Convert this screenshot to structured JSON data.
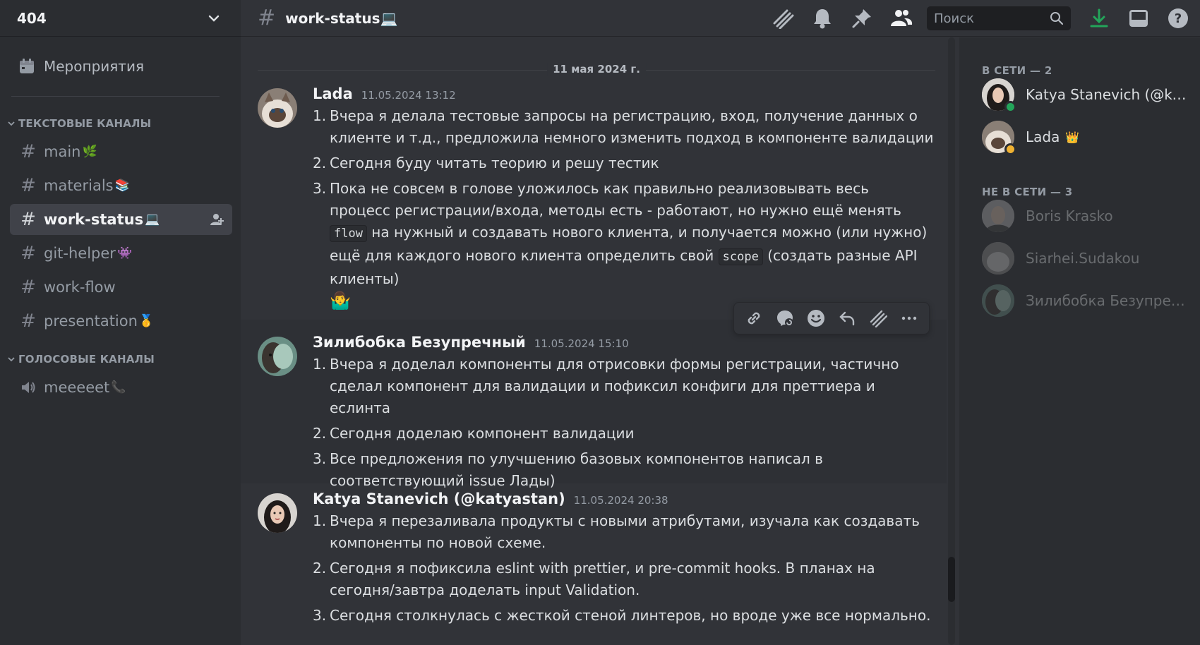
{
  "server": {
    "name": "404"
  },
  "sidebar": {
    "events_label": "Мероприятия",
    "text_category": "ТЕКСТОВЫЕ КАНАЛЫ",
    "voice_category": "ГОЛОСОВЫЕ КАНАЛЫ",
    "channels": [
      {
        "name": "main",
        "emoji": "🌿"
      },
      {
        "name": "materials",
        "emoji": "📚"
      },
      {
        "name": "work-status",
        "emoji": "💻"
      },
      {
        "name": "git-helper",
        "emoji": "👾"
      },
      {
        "name": "work-flow",
        "emoji": ""
      },
      {
        "name": "presentation",
        "emoji": "🥇"
      }
    ],
    "voice_channels": [
      {
        "name": "meeeeet",
        "emoji": "📞"
      }
    ]
  },
  "topbar": {
    "channel_name": "work-status",
    "channel_emoji": "💻",
    "search_placeholder": "Поиск"
  },
  "chat": {
    "date_separator": "11 мая 2024 г.",
    "messages": [
      {
        "author": "Lada",
        "timestamp": "11.05.2024 13:12",
        "items": [
          "Вчера я делала тестовые запросы на регистрацию, вход, получение данных о клиенте и т.д., предложила немного изменить подход в компоненте валидации",
          "Сегодня буду читать теорию и решу тестик",
          {
            "pre": "Пока не совсем в голове уложилось как правильно реализовывать весь процесс регистрации/входа, методы есть - работают, но нужно ещё менять ",
            "code1": "flow",
            "mid": " на нужный и создавать нового клиента, и получается можно (или нужно) ещё для каждого нового клиента определить свой ",
            "code2": "scope",
            "post": " (создать разные API клиенты)",
            "emoji": "🤷‍♂️"
          }
        ]
      },
      {
        "author": "Зилибобка Безупречный",
        "timestamp": "11.05.2024 15:10",
        "items": [
          "Вчера я доделал компоненты для отрисовки формы регистрации, частично сделал компонент для валидации и пофиксил конфиги для преттиера и еслинта",
          "Сегодня доделаю компонент валидации",
          "Все предложения по улучшению базовых компонентов написал в соответствующий issue Лады)"
        ]
      },
      {
        "author": "Katya Stanevich (@katyastan)",
        "timestamp": "11.05.2024 20:38",
        "items": [
          "Вчера я перезаливала продукты с новыми атрибутами, изучала как создавать компоненты по новой схеме.",
          "Сегодня я пофиксила eslint with prettier, и pre-commit hooks. В планах на сегодня/завтра доделать input Validation.",
          "Сегодня столкнулась с жесткой стеной линтеров, но вроде уже все нормально."
        ]
      }
    ]
  },
  "members": {
    "online_header": "В СЕТИ — 2",
    "offline_header": "НЕ В СЕТИ — 3",
    "online": [
      {
        "name": "Katya Stanevich (@katyastan)",
        "status_color": "#23a55a"
      },
      {
        "name": "Lada",
        "badge": "👑",
        "status_color": "#f0b232"
      }
    ],
    "offline": [
      {
        "name": "Boris Krasko"
      },
      {
        "name": "Siarhei.Sudakou"
      },
      {
        "name": "Зилибобка Безупречный"
      }
    ]
  },
  "colors": {
    "sidebar_bg": "#2b2d31",
    "chat_bg": "#313338",
    "download_accent": "#23a55a"
  }
}
